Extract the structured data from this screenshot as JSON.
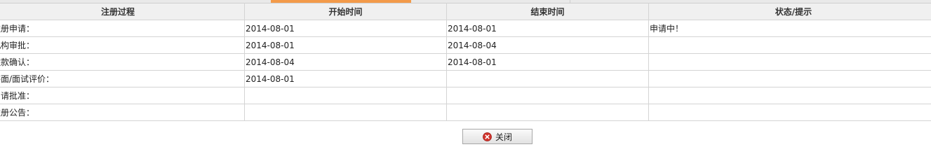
{
  "table": {
    "headers": [
      "注册过程",
      "开始时间",
      "结束时间",
      "状态/提示"
    ],
    "rows": [
      {
        "step": "注册申请：",
        "start": "2014-08-01",
        "end": "2014-08-01",
        "status": "申请中！"
      },
      {
        "step": "机构审批：",
        "start": "2014-08-01",
        "end": "2014-08-04",
        "status": ""
      },
      {
        "step": "缴款确认：",
        "start": "2014-08-04",
        "end": "2014-08-01",
        "status": ""
      },
      {
        "step": "书面/面试评价：",
        "start": "2014-08-01",
        "end": "",
        "status": ""
      },
      {
        "step": "申请批准：",
        "start": "",
        "end": "",
        "status": ""
      },
      {
        "step": "注册公告：",
        "start": "",
        "end": "",
        "status": ""
      }
    ]
  },
  "footer": {
    "close_label": "关闭",
    "close_icon": "close-circle-icon"
  },
  "colors": {
    "accent": "#f39a4a",
    "close_icon_red": "#d0322b"
  }
}
